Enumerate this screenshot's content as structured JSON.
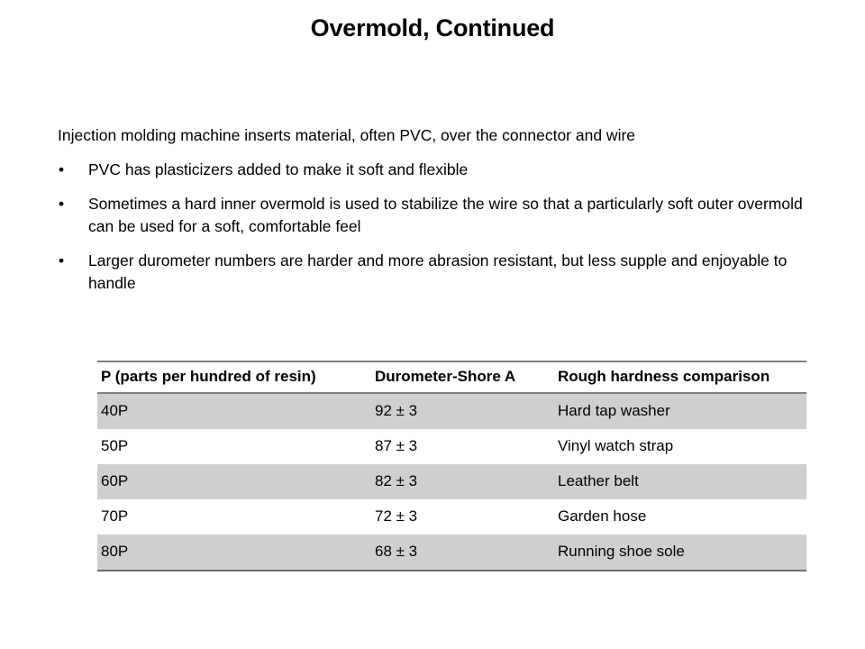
{
  "slide": {
    "title": "Overmold, Continued"
  },
  "body": {
    "lead": "Injection molding machine inserts material, often PVC, over the connector and wire",
    "bullet_mark": "•",
    "bullets": [
      "PVC has plasticizers added to make it soft and flexible",
      "Sometimes a hard inner overmold is used to stabilize the wire so that a particularly soft outer overmold can be used for a soft, comfortable feel",
      "Larger durometer numbers are harder and more abrasion resistant, but less supple and enjoyable to handle"
    ]
  },
  "table": {
    "headers": [
      "P (parts per hundred of resin)",
      "Durometer-Shore A",
      "Rough hardness comparison"
    ],
    "rows": [
      {
        "p": "40P",
        "durometer": "92 ± 3",
        "comparison": "Hard tap washer"
      },
      {
        "p": "50P",
        "durometer": "87 ± 3",
        "comparison": "Vinyl watch strap"
      },
      {
        "p": "60P",
        "durometer": "82 ± 3",
        "comparison": "Leather belt"
      },
      {
        "p": "70P",
        "durometer": "72 ± 3",
        "comparison": "Garden hose"
      },
      {
        "p": "80P",
        "durometer": "68 ± 3",
        "comparison": "Running shoe sole"
      }
    ],
    "shaded_row_color": "#cfcfcf",
    "plain_row_color": "#ffffff",
    "rule_color": "#808080"
  }
}
